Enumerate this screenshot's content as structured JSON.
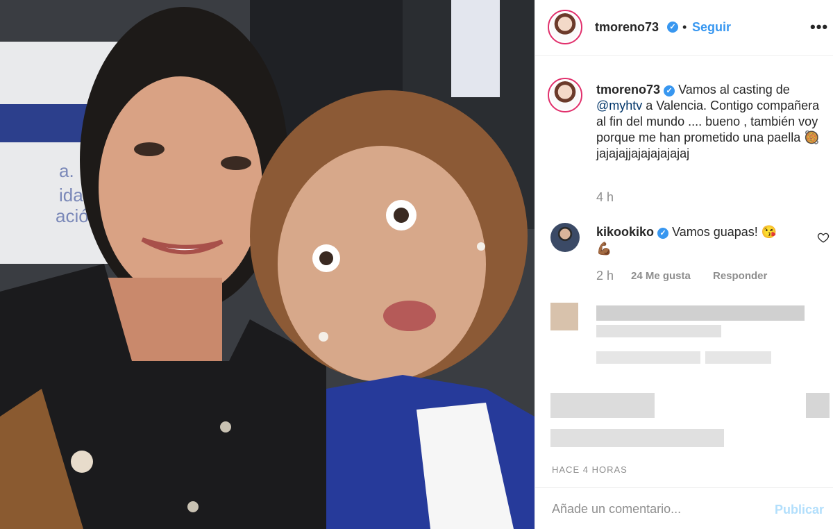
{
  "post": {
    "username": "tmoreno73",
    "separator": "•",
    "follow_label": "Seguir",
    "more_label": "•••"
  },
  "caption": {
    "username": "tmoreno73",
    "text_before_mention": "Vamos al casting de",
    "mention": "@myhtv",
    "text_after_mention": "a Valencia. Contigo compañera al fin del mundo .... bueno , también voy porque me han prometido una paella",
    "emoji": "🥘",
    "text_end": "jajajajjajajajajajaj",
    "time": "4 h"
  },
  "comments": [
    {
      "username": "kikookiko",
      "text": "Vamos guapas! 😘",
      "text_line2": "💪🏾",
      "time": "2 h",
      "likes_label": "24 Me gusta",
      "reply_label": "Responder"
    }
  ],
  "timestamp": "HACE 4 HORAS",
  "comment_box": {
    "placeholder": "Añade un comentario...",
    "publish_label": "Publicar"
  },
  "colors": {
    "accent": "#3897f0",
    "publish_disabled": "#b2dffc",
    "muted": "#8e8e8e"
  },
  "icons": {
    "verified": "verified-badge-icon",
    "heart": "heart-outline-icon",
    "more": "more-options-icon"
  }
}
